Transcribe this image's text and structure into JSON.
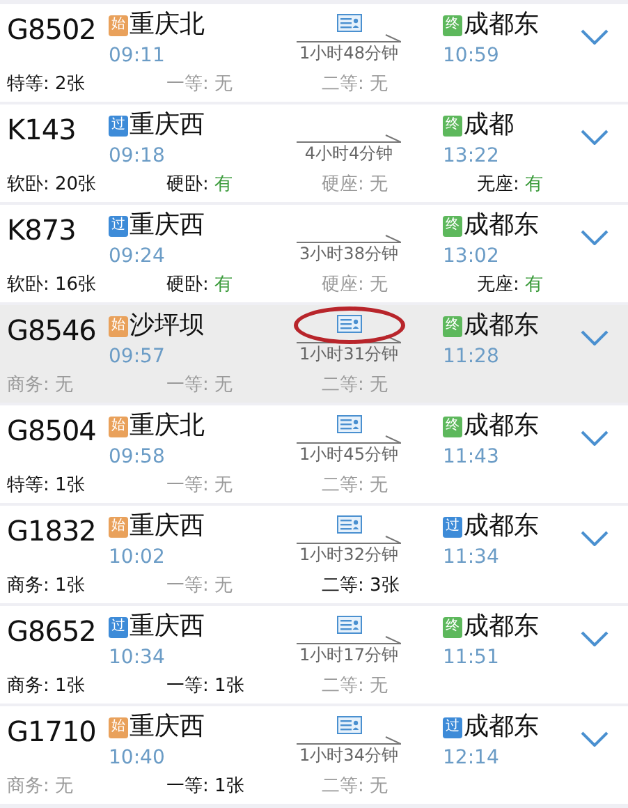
{
  "trains": [
    {
      "train": "G8502",
      "selected": false,
      "circled": false,
      "id_card": true,
      "start": {
        "badge": "始",
        "kind": "start",
        "station": "重庆北",
        "time": "09:11"
      },
      "duration": "1小时48分钟",
      "end": {
        "badge": "终",
        "kind": "end",
        "station": "成都东",
        "time": "10:59"
      },
      "seats": [
        {
          "label": "特等:",
          "value": "2张",
          "kind": "count"
        },
        {
          "label": "一等:",
          "value": "无",
          "kind": "none"
        },
        {
          "label": "二等:",
          "value": "无",
          "kind": "none"
        }
      ]
    },
    {
      "train": "K143",
      "selected": false,
      "circled": false,
      "id_card": false,
      "start": {
        "badge": "过",
        "kind": "pass",
        "station": "重庆西",
        "time": "09:18"
      },
      "duration": "4小时4分钟",
      "end": {
        "badge": "终",
        "kind": "end",
        "station": "成都",
        "time": "13:22"
      },
      "seats": [
        {
          "label": "软卧:",
          "value": "20张",
          "kind": "count"
        },
        {
          "label": "硬卧:",
          "value": "有",
          "kind": "plenty"
        },
        {
          "label": "硬座:",
          "value": "无",
          "kind": "none"
        },
        {
          "label": "无座:",
          "value": "有",
          "kind": "plenty"
        }
      ]
    },
    {
      "train": "K873",
      "selected": false,
      "circled": false,
      "id_card": false,
      "start": {
        "badge": "过",
        "kind": "pass",
        "station": "重庆西",
        "time": "09:24"
      },
      "duration": "3小时38分钟",
      "end": {
        "badge": "终",
        "kind": "end",
        "station": "成都东",
        "time": "13:02"
      },
      "seats": [
        {
          "label": "软卧:",
          "value": "16张",
          "kind": "count"
        },
        {
          "label": "硬卧:",
          "value": "有",
          "kind": "plenty"
        },
        {
          "label": "硬座:",
          "value": "无",
          "kind": "none"
        },
        {
          "label": "无座:",
          "value": "有",
          "kind": "plenty"
        }
      ]
    },
    {
      "train": "G8546",
      "selected": true,
      "circled": true,
      "id_card": true,
      "start": {
        "badge": "始",
        "kind": "start",
        "station": "沙坪坝",
        "time": "09:57"
      },
      "duration": "1小时31分钟",
      "end": {
        "badge": "终",
        "kind": "end",
        "station": "成都东",
        "time": "11:28"
      },
      "seats": [
        {
          "label": "商务:",
          "value": "无",
          "kind": "none"
        },
        {
          "label": "一等:",
          "value": "无",
          "kind": "none"
        },
        {
          "label": "二等:",
          "value": "无",
          "kind": "none"
        }
      ]
    },
    {
      "train": "G8504",
      "selected": false,
      "circled": false,
      "id_card": true,
      "start": {
        "badge": "始",
        "kind": "start",
        "station": "重庆北",
        "time": "09:58"
      },
      "duration": "1小时45分钟",
      "end": {
        "badge": "终",
        "kind": "end",
        "station": "成都东",
        "time": "11:43"
      },
      "seats": [
        {
          "label": "特等:",
          "value": "1张",
          "kind": "count"
        },
        {
          "label": "一等:",
          "value": "无",
          "kind": "none"
        },
        {
          "label": "二等:",
          "value": "无",
          "kind": "none"
        }
      ]
    },
    {
      "train": "G1832",
      "selected": false,
      "circled": false,
      "id_card": true,
      "start": {
        "badge": "始",
        "kind": "start",
        "station": "重庆西",
        "time": "10:02"
      },
      "duration": "1小时32分钟",
      "end": {
        "badge": "过",
        "kind": "pass",
        "station": "成都东",
        "time": "11:34"
      },
      "seats": [
        {
          "label": "商务:",
          "value": "1张",
          "kind": "count"
        },
        {
          "label": "一等:",
          "value": "无",
          "kind": "none"
        },
        {
          "label": "二等:",
          "value": "3张",
          "kind": "count"
        }
      ]
    },
    {
      "train": "G8652",
      "selected": false,
      "circled": false,
      "id_card": true,
      "start": {
        "badge": "过",
        "kind": "pass",
        "station": "重庆西",
        "time": "10:34"
      },
      "duration": "1小时17分钟",
      "end": {
        "badge": "终",
        "kind": "end",
        "station": "成都东",
        "time": "11:51"
      },
      "seats": [
        {
          "label": "商务:",
          "value": "1张",
          "kind": "count"
        },
        {
          "label": "一等:",
          "value": "1张",
          "kind": "count"
        },
        {
          "label": "二等:",
          "value": "无",
          "kind": "none"
        }
      ]
    },
    {
      "train": "G1710",
      "selected": false,
      "circled": false,
      "id_card": true,
      "start": {
        "badge": "始",
        "kind": "start",
        "station": "重庆西",
        "time": "10:40"
      },
      "duration": "1小时34分钟",
      "end": {
        "badge": "过",
        "kind": "pass",
        "station": "成都东",
        "time": "12:14"
      },
      "seats": [
        {
          "label": "商务:",
          "value": "无",
          "kind": "none"
        },
        {
          "label": "一等:",
          "value": "1张",
          "kind": "count"
        },
        {
          "label": "二等:",
          "value": "无",
          "kind": "none"
        }
      ]
    }
  ]
}
